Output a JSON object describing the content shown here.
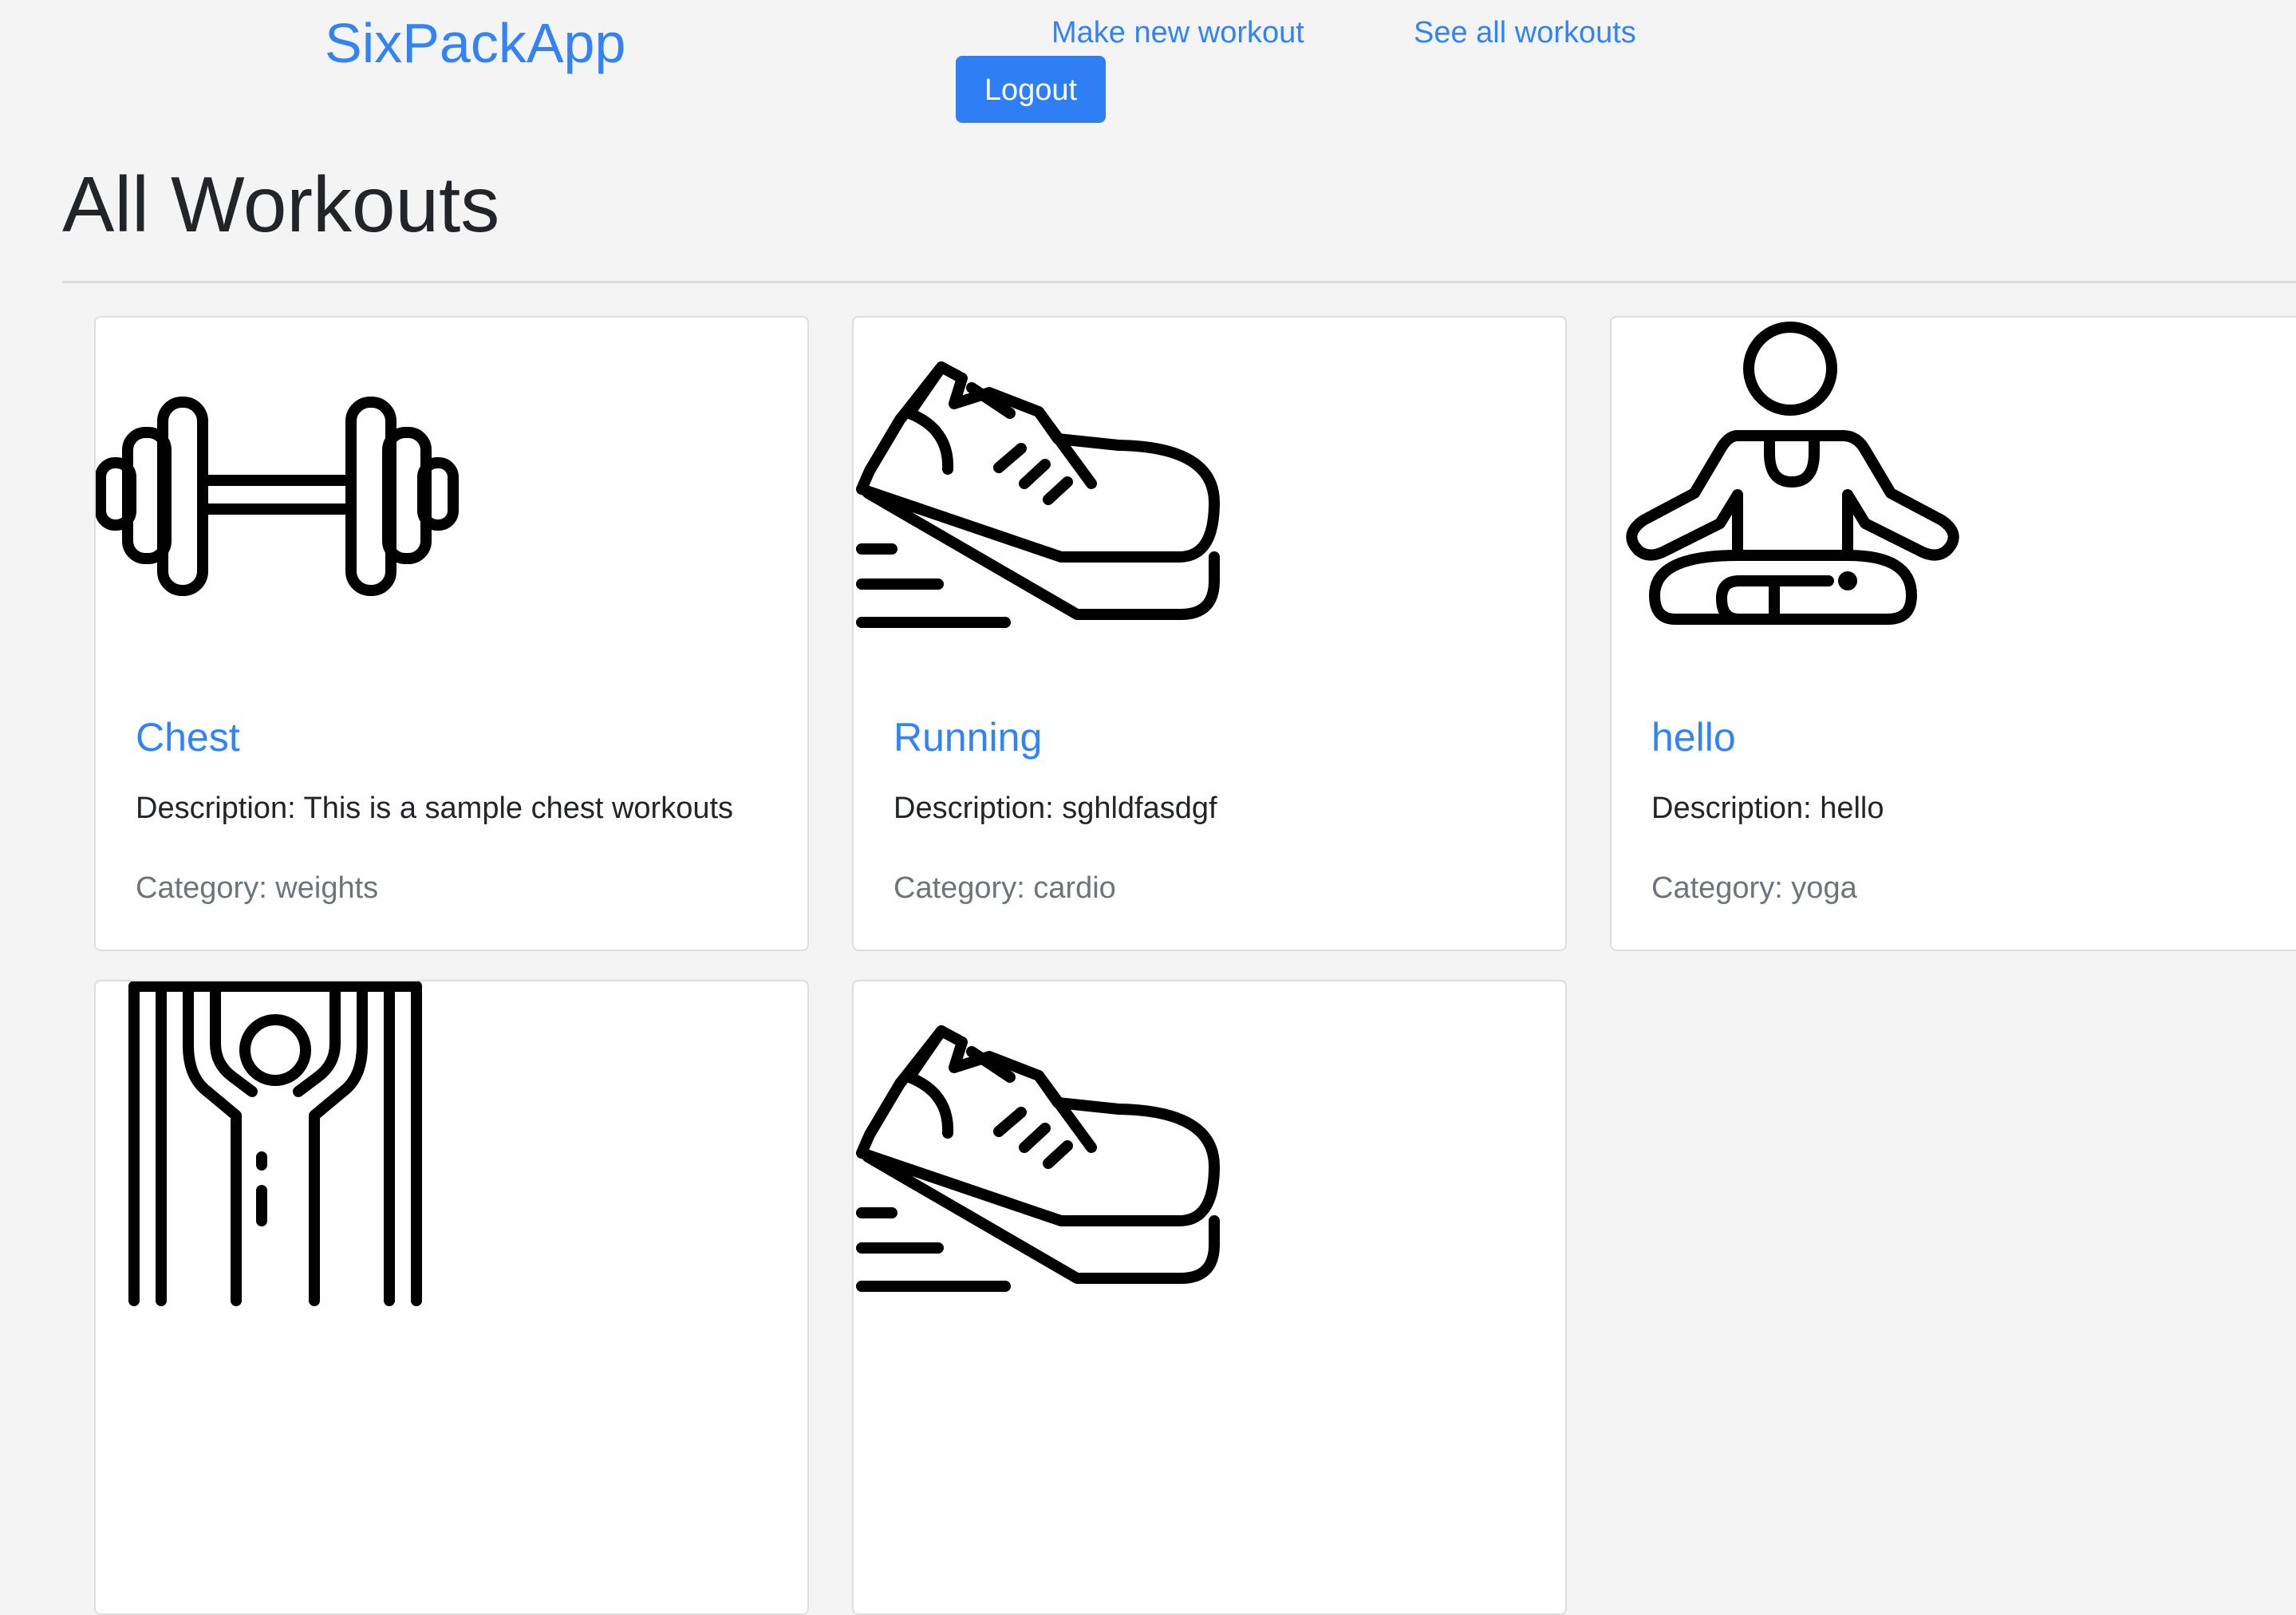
{
  "nav": {
    "brand": "SixPackApp",
    "make_new": "Make new workout",
    "see_all": "See all workouts",
    "logout": "Logout"
  },
  "page": {
    "title": "All Workouts"
  },
  "colors": {
    "brand": "#3283f6",
    "button": "#2f7ff4",
    "background": "#f4f4f4",
    "muted": "#6c757d"
  },
  "workouts": [
    {
      "icon": "dumbbell-icon",
      "title": "Chest",
      "description": "Description: This is a sample chest workouts",
      "category": "Category: weights"
    },
    {
      "icon": "running-shoe-icon",
      "title": "Running",
      "description": "Description: sghldfasdgf",
      "category": "Category: cardio"
    },
    {
      "icon": "yoga-pose-icon",
      "title": "hello",
      "description": "Description: hello",
      "category": "Category: yoga"
    },
    {
      "icon": "pull-up-bar-icon"
    },
    {
      "icon": "running-shoe-icon"
    }
  ]
}
